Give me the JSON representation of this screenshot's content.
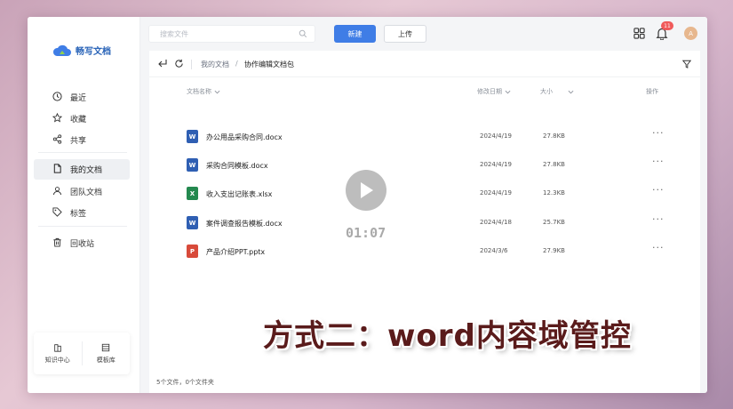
{
  "app": {
    "logo_text": "畅写文档"
  },
  "sidebar": {
    "items": [
      {
        "label": "最近",
        "icon": "clock-icon"
      },
      {
        "label": "收藏",
        "icon": "star-icon"
      },
      {
        "label": "共享",
        "icon": "share-icon"
      },
      {
        "label": "我的文档",
        "icon": "document-icon",
        "active": true
      },
      {
        "label": "团队文档",
        "icon": "team-icon"
      },
      {
        "label": "标签",
        "icon": "tag-icon"
      },
      {
        "label": "回收站",
        "icon": "trash-icon"
      }
    ],
    "bottom": [
      {
        "label": "知识中心",
        "icon": "knowledge-icon"
      },
      {
        "label": "模板库",
        "icon": "template-icon"
      }
    ]
  },
  "topbar": {
    "search_placeholder": "搜索文件",
    "new_label": "新建",
    "upload_label": "上传",
    "notification_count": "11",
    "avatar_initial": "A"
  },
  "breadcrumb": {
    "root": "我的文档",
    "separator": "/",
    "current": "协作编辑文档包"
  },
  "table": {
    "columns": {
      "name": "文档名称",
      "date": "修改日期",
      "size": "大小",
      "actions": "操作"
    },
    "rows": [
      {
        "name": "办公用品采购合同.docx",
        "date": "2024/4/19",
        "size": "27.8KB",
        "type": "word",
        "icon_letter": "W",
        "color": "#2f5fb3"
      },
      {
        "name": "采购合同模板.docx",
        "date": "2024/4/19",
        "size": "27.8KB",
        "type": "word",
        "icon_letter": "W",
        "color": "#2f5fb3"
      },
      {
        "name": "收入支出记账表.xlsx",
        "date": "2024/4/19",
        "size": "12.3KB",
        "type": "excel",
        "icon_letter": "X",
        "color": "#24894f"
      },
      {
        "name": "案件调查报告模板.docx",
        "date": "2024/4/18",
        "size": "25.7KB",
        "type": "word",
        "icon_letter": "W",
        "color": "#2f5fb3"
      },
      {
        "name": "产品介绍PPT.pptx",
        "date": "2024/3/6",
        "size": "27.9KB",
        "type": "ppt",
        "icon_letter": "P",
        "color": "#d84a3a"
      }
    ],
    "more_label": "···"
  },
  "footer": {
    "summary": "5个文件，0个文件夹"
  },
  "video_overlay": {
    "timer": "01:07",
    "caption": "方式二：word内容域管控"
  }
}
